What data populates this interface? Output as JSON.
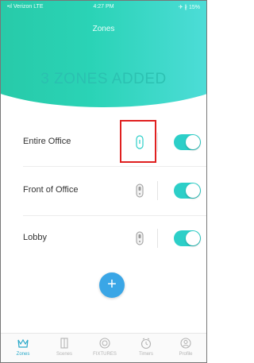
{
  "status_bar": {
    "carrier": "•ıl Verizon LTE",
    "time": "4:27 PM",
    "battery": "✈ ∦ 15%"
  },
  "header": {
    "title": "Zones",
    "banner": "3 ZONES ADDED"
  },
  "zones": [
    {
      "name": "Entire Office",
      "device_icon": "door-sensor-icon",
      "enabled": true
    },
    {
      "name": "Front of Office",
      "device_icon": "switch-icon",
      "enabled": true
    },
    {
      "name": "Lobby",
      "device_icon": "switch-icon",
      "enabled": true
    }
  ],
  "add_button": {
    "label": "+"
  },
  "tabs": [
    {
      "label": "Zones",
      "icon": "zones-icon",
      "active": true
    },
    {
      "label": "Scenes",
      "icon": "scenes-icon",
      "active": false
    },
    {
      "label": "FIXTURES",
      "icon": "fixtures-icon",
      "active": false
    },
    {
      "label": "Timers",
      "icon": "timer-icon",
      "active": false
    },
    {
      "label": "Profile",
      "icon": "profile-icon",
      "active": false
    }
  ],
  "colors": {
    "accent": "#2ccfc8",
    "highlight": "#e02020",
    "add_button": "#3aa6e6",
    "active_tab": "#2aa9c9"
  }
}
